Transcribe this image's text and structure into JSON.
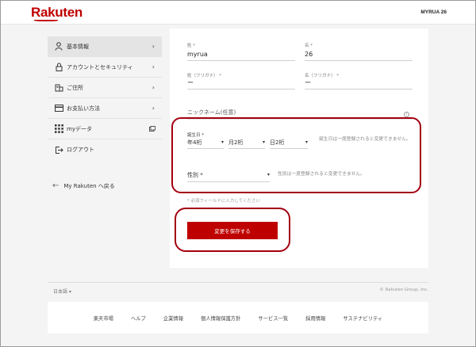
{
  "header": {
    "logo": "Rakuten",
    "username": "MYRUA 26"
  },
  "sidebar": {
    "items": [
      {
        "label": "基本情報",
        "icon": "person-icon",
        "active": true
      },
      {
        "label": "アカウントとセキュリティ",
        "icon": "lock-icon"
      },
      {
        "label": "ご住所",
        "icon": "address-icon"
      },
      {
        "label": "お支払い方法",
        "icon": "credit-card-icon"
      },
      {
        "label": "myデータ",
        "icon": "grid-icon"
      },
      {
        "label": "ログアウト",
        "icon": "logout-icon"
      }
    ],
    "back_link": "My Rakuten へ戻る"
  },
  "form": {
    "last_name_label": "姓 *",
    "last_name_value": "myrua",
    "first_name_label": "名 *",
    "first_name_value": "26",
    "last_kana_label": "姓（フリガナ） *",
    "last_kana_value": "ー",
    "first_kana_label": "名（フリガナ） *",
    "first_kana_value": "ー",
    "nickname_label": "ニックネーム(任意)",
    "birthday_label": "誕生日 *",
    "year_select": "年4桁",
    "month_select": "月2桁",
    "day_select": "日2桁",
    "birthday_note": "誕生日は一度登録されると変更できません。",
    "gender_select": "性別 *",
    "gender_note": "性別は一度登録されると変更できません。",
    "required_note": "* 必須フィールドに入力してください",
    "save_button": "変更を保存する"
  },
  "footer": {
    "language": "日本語 ▾",
    "copyright": "© Rakuten Group, Inc.",
    "links": [
      "楽天市場",
      "ヘルプ",
      "企業情報",
      "個人情報保護方針",
      "サービス一覧",
      "採用情報",
      "サステナビリティ"
    ]
  },
  "colors": {
    "brand": "#bf0000",
    "highlight_oval": "#a30010"
  }
}
